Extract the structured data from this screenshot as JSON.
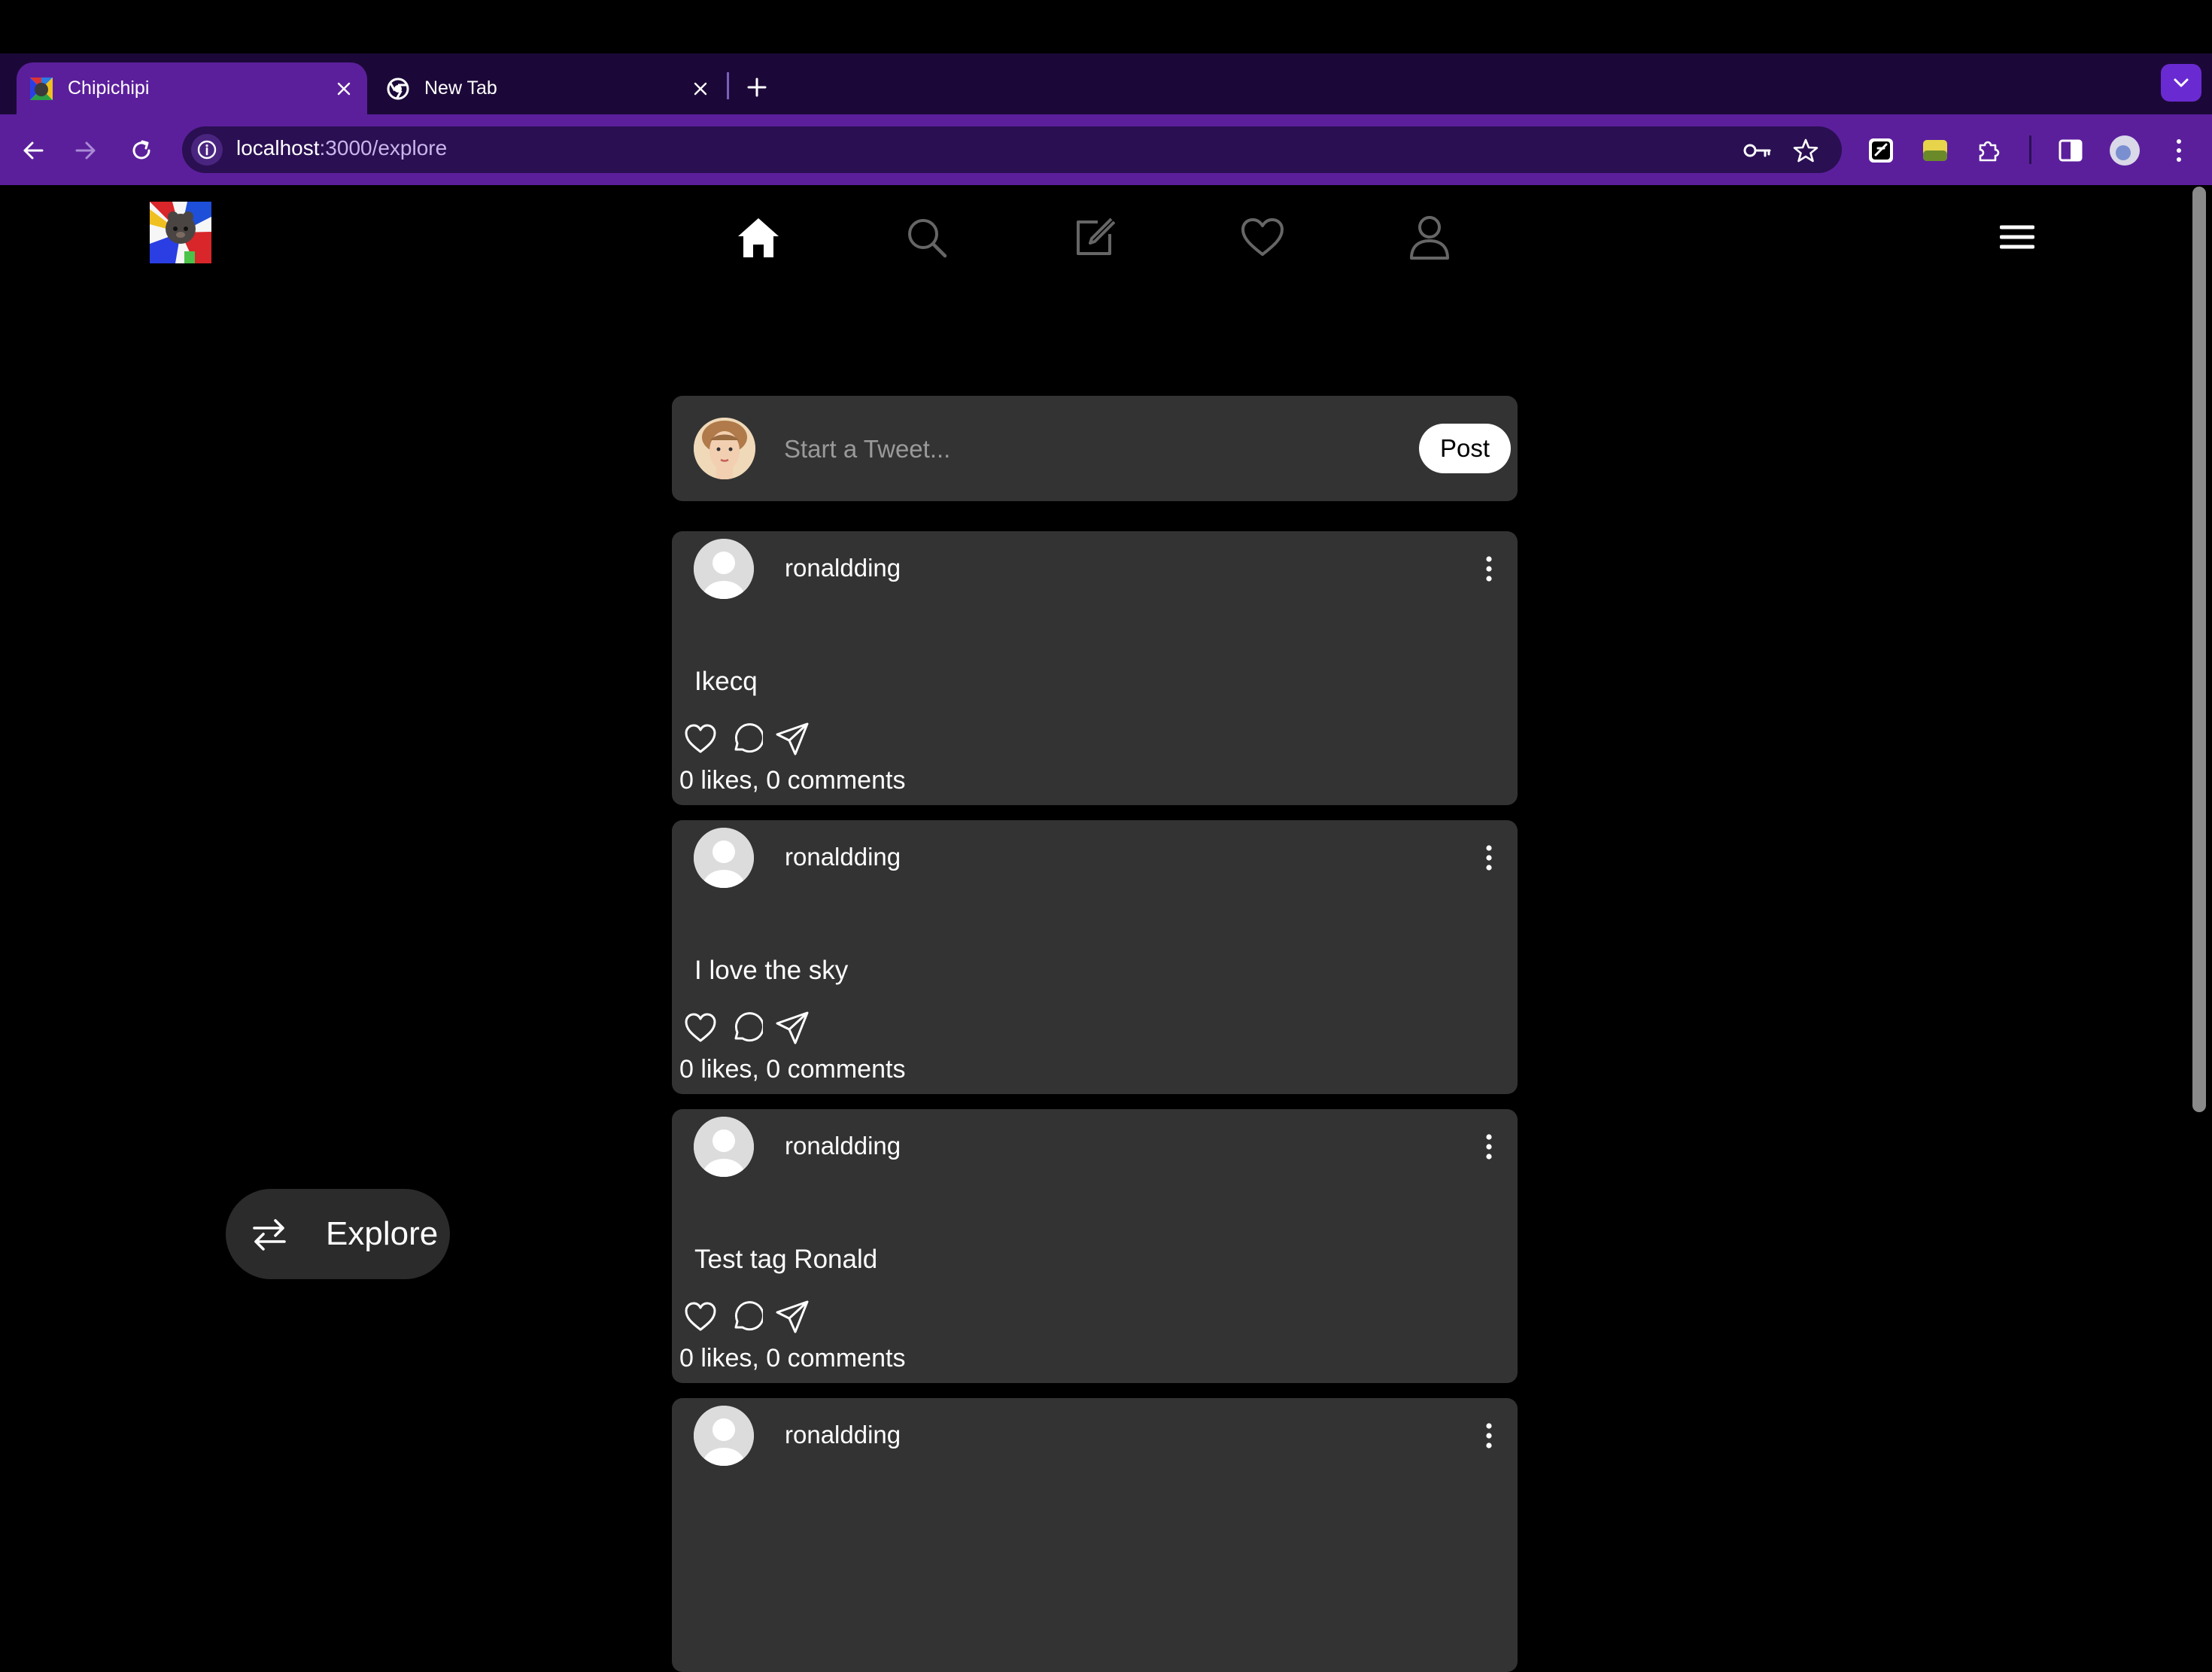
{
  "browser": {
    "tabs": [
      {
        "title": "Chipichipi",
        "active": true
      },
      {
        "title": "New Tab",
        "active": false
      }
    ],
    "url": {
      "host": "localhost",
      "rest": ":3000/explore"
    },
    "colors": {
      "tabstrip": "#1c0838",
      "toolbar": "#5b1f9c",
      "omnibox": "#2a0f52"
    }
  },
  "app": {
    "nav_icons": [
      "home-icon",
      "search-icon",
      "compose-icon",
      "heart-icon",
      "profile-icon"
    ],
    "composer": {
      "placeholder": "Start a Tweet...",
      "post_label": "Post"
    },
    "posts": [
      {
        "username": "ronaldding",
        "text": "Ikecq",
        "stats": "0 likes, 0 comments"
      },
      {
        "username": "ronaldding",
        "text": "I love the sky",
        "stats": "0 likes, 0 comments"
      },
      {
        "username": "ronaldding",
        "text": "Test tag Ronald",
        "stats": "0 likes, 0 comments"
      },
      {
        "username": "ronaldding",
        "text": "",
        "stats": ""
      }
    ],
    "explore_button": {
      "label": "Explore"
    },
    "colors": {
      "background": "#000000",
      "card": "#333333"
    }
  }
}
